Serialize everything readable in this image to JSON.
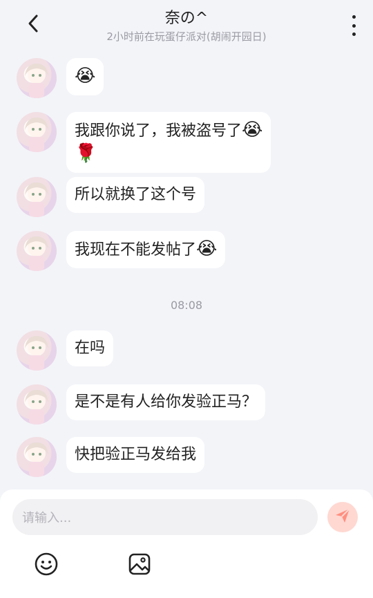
{
  "header": {
    "title": "奈の^",
    "subtitle": "2小时前在玩蛋仔派对(胡闹开园日)"
  },
  "messages": [
    {
      "text": "",
      "emoji": "😭"
    },
    {
      "text": "我跟你说了，我被盗号了",
      "emoji": "😭",
      "extra": "🌹"
    },
    {
      "text": "所以就换了这个号",
      "emoji": ""
    },
    {
      "text": "我现在不能发帖了",
      "emoji": "😭"
    },
    {
      "text": "在吗",
      "emoji": ""
    },
    {
      "text": "是不是有人给你发验正马？",
      "emoji": ""
    },
    {
      "text": "快把验正马发给我",
      "emoji": ""
    }
  ],
  "timestamp": "08:08",
  "composer": {
    "placeholder": "请输入..."
  },
  "icons": {
    "back": "chevron-left-icon",
    "more": "more-vertical-icon",
    "send": "send-icon",
    "emoji": "emoji-icon",
    "image": "image-icon"
  },
  "colors": {
    "background": "#f3f4f8",
    "bubble": "#ffffff",
    "send_button": "#ffd8d2",
    "send_glyph": "#ff8f80"
  }
}
